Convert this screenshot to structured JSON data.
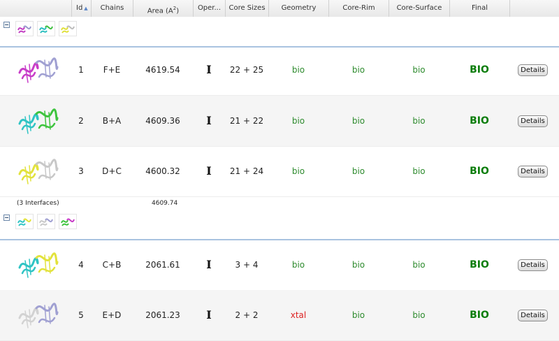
{
  "columns": {
    "id": "Id",
    "chains": "Chains",
    "area": "Area (A",
    "area_sup": "2",
    "area_close": ")",
    "oper": "Oper...",
    "core_sizes": "Core Sizes",
    "geometry": "Geometry",
    "core_rim": "Core-Rim",
    "core_surface": "Core-Surface",
    "final": "Final"
  },
  "colors": {
    "bio": "#0a7d0a",
    "xtal": "#dd2222",
    "header_border": "#a9c3e0"
  },
  "groups": [
    {
      "thumbnail_colors": [
        [
          "#c23cc2",
          "#9a9acd"
        ],
        [
          "#29bfbf",
          "#3fbf3f"
        ],
        [
          "#e0e03a",
          "#bdbdbd"
        ]
      ],
      "rows": [
        {
          "id": "1",
          "chains": "F+E",
          "area": "4619.54",
          "operator": "I",
          "core_sizes": "22 + 25",
          "geometry": "bio",
          "core_rim": "bio",
          "core_surface": "bio",
          "final": "BIO",
          "details": "Details",
          "mol_colors": [
            "#c83cc8",
            "#a0a0d2"
          ]
        },
        {
          "id": "2",
          "chains": "B+A",
          "area": "4609.36",
          "operator": "I",
          "core_sizes": "21 + 22",
          "geometry": "bio",
          "core_rim": "bio",
          "core_surface": "bio",
          "final": "BIO",
          "details": "Details",
          "mol_colors": [
            "#2fc4c4",
            "#3ec43e"
          ]
        },
        {
          "id": "3",
          "chains": "D+C",
          "area": "4600.32",
          "operator": "I",
          "core_sizes": "21 + 24",
          "geometry": "bio",
          "core_rim": "bio",
          "core_surface": "bio",
          "final": "BIO",
          "details": "Details",
          "mol_colors": [
            "#e2e23c",
            "#c8c8c8"
          ]
        }
      ],
      "summary": {
        "label": "(3 Interfaces)",
        "area": "4609.74"
      }
    },
    {
      "thumbnail_colors": [
        [
          "#2fc4c4",
          "#e2e23c"
        ],
        [
          "#c8c8c8",
          "#a0a0d2"
        ],
        [
          "#3ec43e",
          "#c83cc8"
        ]
      ],
      "rows": [
        {
          "id": "4",
          "chains": "C+B",
          "area": "2061.61",
          "operator": "I",
          "core_sizes": "3 + 4",
          "geometry": "bio",
          "core_rim": "bio",
          "core_surface": "bio",
          "final": "BIO",
          "details": "Details",
          "mol_colors": [
            "#2fc4c4",
            "#e2e23c"
          ]
        },
        {
          "id": "5",
          "chains": "E+D",
          "area": "2061.23",
          "operator": "I",
          "core_sizes": "2 + 2",
          "geometry": "xtal",
          "core_rim": "bio",
          "core_surface": "bio",
          "final": "BIO",
          "details": "Details",
          "mol_colors": [
            "#d2d2d2",
            "#a0a0d2"
          ]
        }
      ]
    }
  ]
}
